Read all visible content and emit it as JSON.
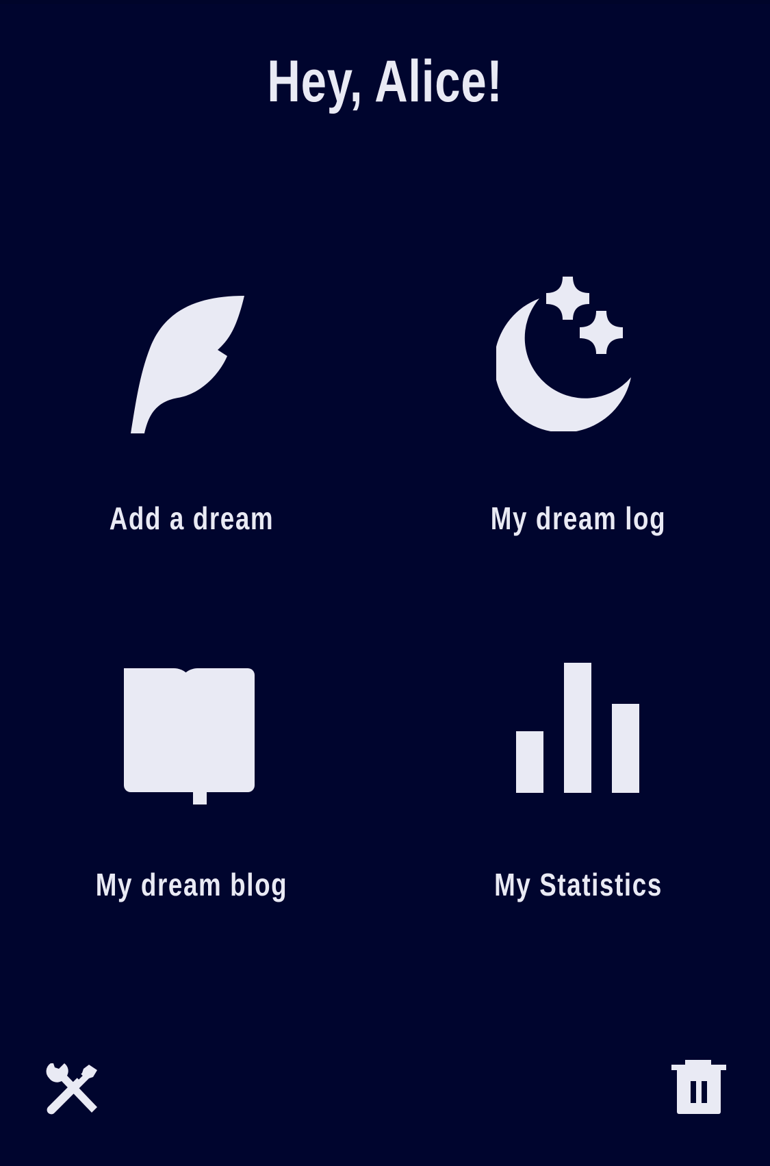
{
  "header": {
    "greeting": "Hey, Alice!"
  },
  "menu": {
    "add_dream": {
      "label": "Add a dream",
      "icon": "feather-icon"
    },
    "dream_log": {
      "label": "My dream log",
      "icon": "moon-stars-icon"
    },
    "dream_blog": {
      "label": "My dream blog",
      "icon": "book-icon"
    },
    "statistics": {
      "label": "My Statistics",
      "icon": "bar-chart-icon"
    }
  },
  "footer": {
    "settings_icon": "tools-icon",
    "delete_icon": "trash-icon"
  },
  "colors": {
    "background": "#00052e",
    "foreground": "#e9eaf4"
  }
}
